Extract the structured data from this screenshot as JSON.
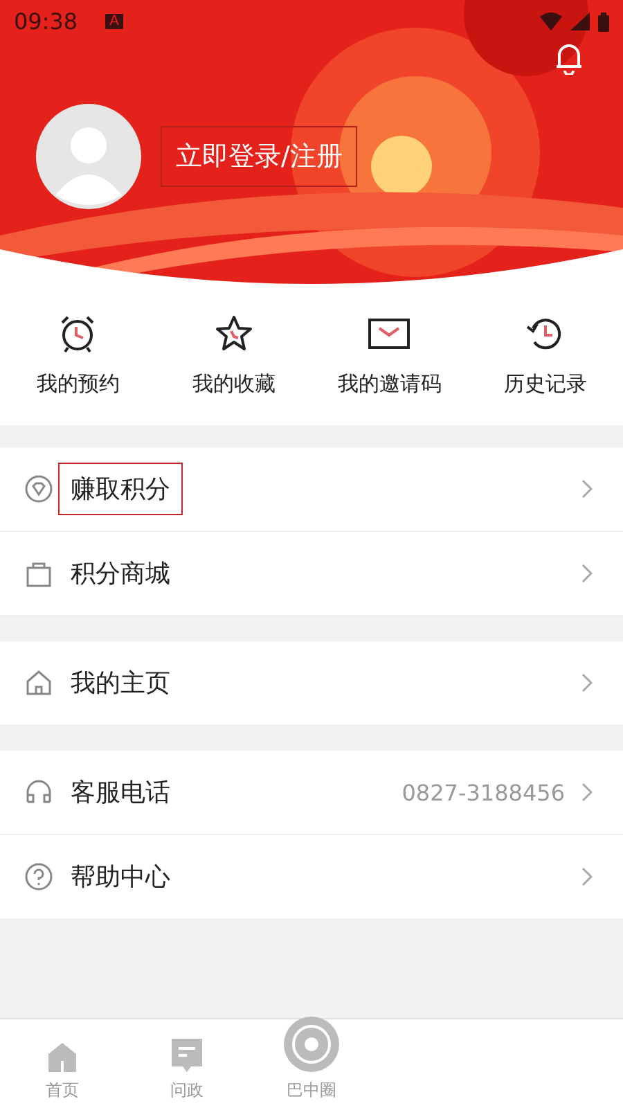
{
  "status_bar": {
    "time": "09:38",
    "badge": "A"
  },
  "profile": {
    "login_text": "立即登录/注册",
    "highlighted": true
  },
  "shortcuts": [
    {
      "label": "我的预约",
      "kind": "alarm"
    },
    {
      "label": "我的收藏",
      "kind": "star"
    },
    {
      "label": "我的邀请码",
      "kind": "mail"
    },
    {
      "label": "历史记录",
      "kind": "history"
    }
  ],
  "menu_groups": [
    [
      {
        "label": "赚取积分",
        "kind": "points",
        "highlighted": true
      },
      {
        "label": "积分商城",
        "kind": "mall",
        "highlighted": false
      }
    ],
    [
      {
        "label": "我的主页",
        "kind": "home",
        "highlighted": false
      }
    ],
    [
      {
        "label": "客服电话",
        "kind": "phone",
        "value": "0827-3188456",
        "highlighted": false
      },
      {
        "label": "帮助中心",
        "kind": "help",
        "highlighted": false
      }
    ]
  ],
  "tab_bar": [
    {
      "label": "首页",
      "kind": "home",
      "selected": false
    },
    {
      "label": "问政",
      "kind": "chat",
      "selected": false
    },
    {
      "label": "巴中圈",
      "kind": "circle",
      "selected": false
    }
  ]
}
